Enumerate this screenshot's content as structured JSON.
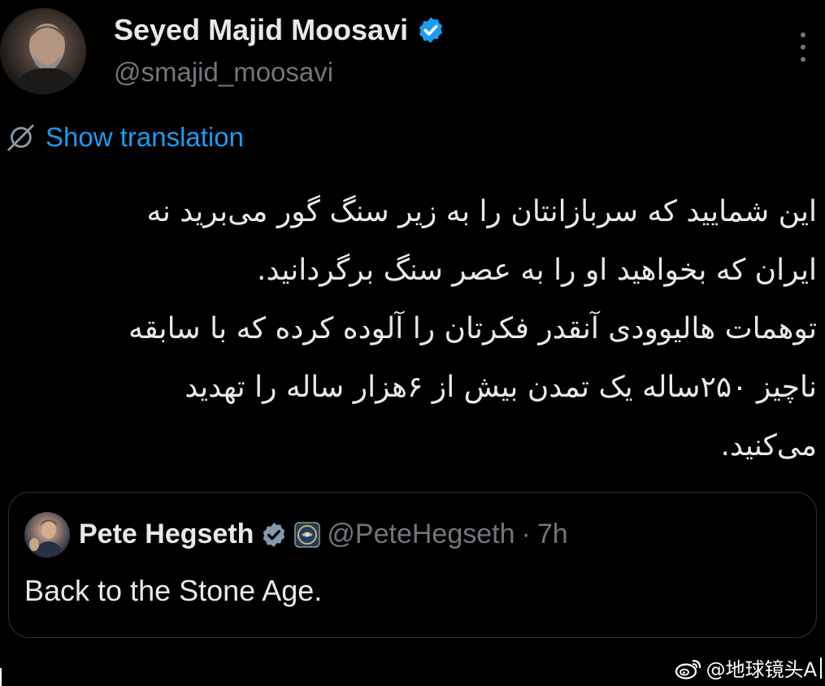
{
  "author": {
    "name": "Seyed Majid Moosavi",
    "handle": "@smajid_moosavi",
    "verified": true
  },
  "translate": {
    "label": "Show translation",
    "icon": "globe-slash-icon"
  },
  "tweet": {
    "lines": [
      "این شمایید که سربازانتان را به زیر سنگ گور می‌برید نه",
      "ایران که بخواهید او را به عصر سنگ برگردانید.",
      "توهمات هالیوودی آنقدر فکرتان را آلوده کرده که با سابقه",
      "ناچیز ۲۵۰ساله یک تمدن بیش از ۶هزار ساله را تهدید",
      "می‌کنید."
    ]
  },
  "quote": {
    "name": "Pete Hegseth",
    "handle": "@PeteHegseth",
    "separator": "·",
    "time": "7h",
    "text": "Back to the Stone Age."
  },
  "watermark": {
    "text": "@地球镜头A",
    "icon": "weibo-icon"
  },
  "colors": {
    "background": "#000000",
    "text": "#e7e9ea",
    "secondary": "#71767b",
    "link": "#1d9bf0",
    "verified": "#1d9bf0",
    "border": "#2f3336"
  }
}
